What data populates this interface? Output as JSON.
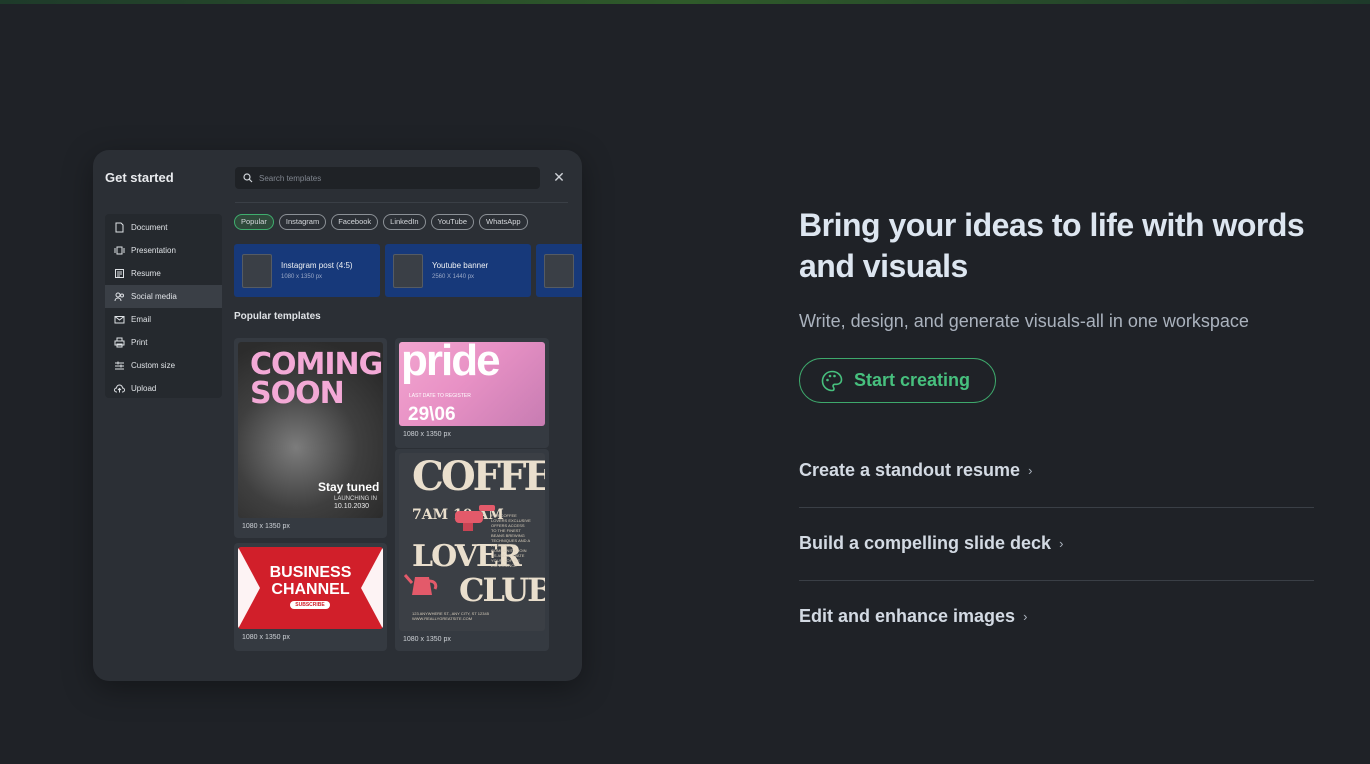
{
  "panel": {
    "title": "Get started",
    "search_placeholder": "Search templates",
    "close_symbol": "✕",
    "sidebar": [
      {
        "label": "Document",
        "icon": "document-icon"
      },
      {
        "label": "Presentation",
        "icon": "presentation-icon"
      },
      {
        "label": "Resume",
        "icon": "resume-icon"
      },
      {
        "label": "Social media",
        "icon": "social-media-icon",
        "active": true
      },
      {
        "label": "Email",
        "icon": "email-icon"
      },
      {
        "label": "Print",
        "icon": "print-icon"
      },
      {
        "label": "Custom size",
        "icon": "custom-size-icon"
      },
      {
        "label": "Upload",
        "icon": "upload-icon"
      }
    ],
    "chips": [
      "Popular",
      "Instagram",
      "Facebook",
      "LinkedIn",
      "YouTube",
      "WhatsApp"
    ],
    "sizes": [
      {
        "name": "Instagram post (4:5)",
        "dims": "1080 x 1350 px"
      },
      {
        "name": "Youtube banner",
        "dims": "2560 X 1440 px"
      },
      {
        "name": "",
        "dims": ""
      }
    ],
    "popular_heading": "Popular templates",
    "templates": {
      "coming_soon": {
        "headline": "COMING SOON",
        "tagline": "Stay tuned",
        "launch": "LAUNCHING IN",
        "date": "10.10.2030",
        "caption": "1080 x 1350 px"
      },
      "pride": {
        "headline": "pride",
        "sub": "LAST DATE TO REGISTER",
        "date": "29\\06",
        "caption": "1080 x 1350 px"
      },
      "business": {
        "headline": "BUSINESS CHANNEL",
        "button": "SUBSCRIBE",
        "caption": "1080 x 1350 px"
      },
      "coffee": {
        "headline": "COFFEE",
        "time": "7AM 10 AM",
        "lover": "LOVER",
        "club": "CLUB",
        "body": "FOR COFFEE LOVERS EXCLUSIVE OFFERS ACCESS TO THE FINEST BEANS BREWING TECHNIQUES AND A PASSIONATE COMMUNITY. JOIN US AND ELEVATE YOUR COFFEE EXPERIENCE",
        "address": "123 ANYWHERE ST., ANY CITY, ST 12345  WWW.REALLYGREATSITE.COM",
        "caption": "1080 x 1350 px"
      }
    }
  },
  "hero": {
    "title": "Bring your ideas to life with words and visuals",
    "subtitle": "Write, design, and generate visuals-all in one workspace",
    "cta": "Start creating",
    "features": [
      "Create a standout resume",
      "Build a compelling slide deck",
      "Edit and enhance images"
    ],
    "chevron": "›"
  },
  "colors": {
    "background": "#1f2227",
    "accent": "#47c07e",
    "panel": "#2b2f35"
  }
}
